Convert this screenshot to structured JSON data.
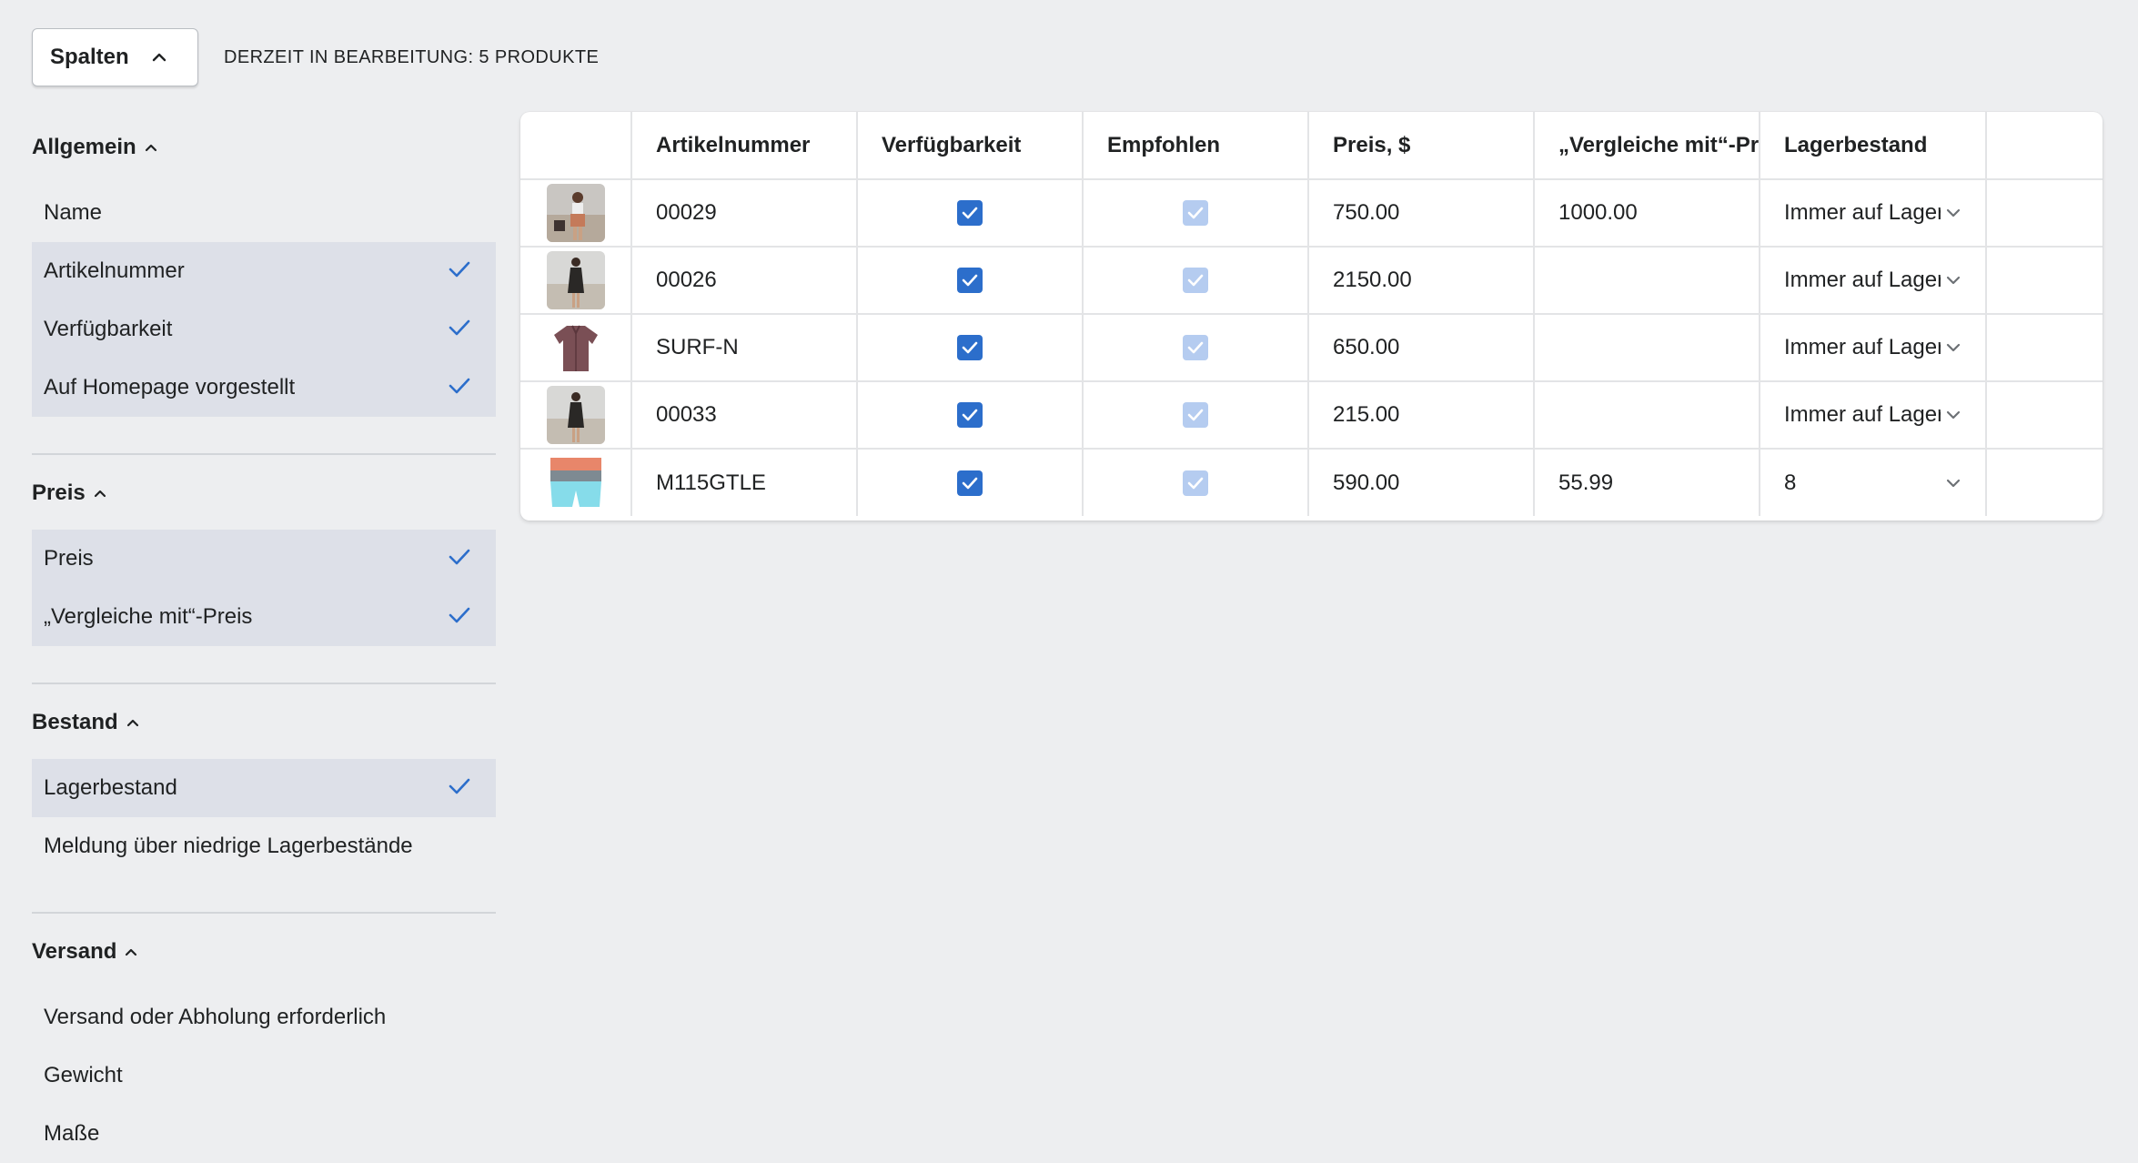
{
  "toolbar": {
    "columns_button_label": "Spalten",
    "editing_status": "DERZEIT IN BEARBEITUNG: 5 PRODUKTE"
  },
  "sidebar": {
    "groups": [
      {
        "title": "Allgemein",
        "items": [
          {
            "label": "Name",
            "selected": false
          },
          {
            "label": "Artikelnummer",
            "selected": true
          },
          {
            "label": "Verfügbarkeit",
            "selected": true
          },
          {
            "label": "Auf Homepage vorgestellt",
            "selected": true
          }
        ]
      },
      {
        "title": "Preis",
        "items": [
          {
            "label": "Preis",
            "selected": true
          },
          {
            "label": "„Vergleiche mit“-Preis",
            "selected": true
          }
        ]
      },
      {
        "title": "Bestand",
        "items": [
          {
            "label": "Lagerbestand",
            "selected": true
          },
          {
            "label": "Meldung über niedrige Lagerbestände",
            "selected": false
          }
        ]
      },
      {
        "title": "Versand",
        "items": [
          {
            "label": "Versand oder Abholung erforderlich",
            "selected": false
          },
          {
            "label": "Gewicht",
            "selected": false
          },
          {
            "label": "Maße",
            "selected": false
          }
        ]
      }
    ]
  },
  "table": {
    "headers": [
      "",
      "Artikelnummer",
      "Verfügbarkeit",
      "Empfohlen",
      "Preis, $",
      "„Vergleiche mit“-Preis",
      "Lagerbestand",
      ""
    ],
    "rows": [
      {
        "image": "product-photo-woman-beach",
        "sku": "00029",
        "available": true,
        "featured": true,
        "price": "750.00",
        "compare_price": "1000.00",
        "stock": "Immer auf Lager"
      },
      {
        "image": "product-photo-black-dress",
        "sku": "00026",
        "available": true,
        "featured": true,
        "price": "2150.00",
        "compare_price": "",
        "stock": "Immer auf Lager"
      },
      {
        "image": "product-photo-shirt",
        "sku": "SURF-N",
        "available": true,
        "featured": true,
        "price": "650.00",
        "compare_price": "",
        "stock": "Immer auf Lager"
      },
      {
        "image": "product-photo-black-dress",
        "sku": "00033",
        "available": true,
        "featured": true,
        "price": "215.00",
        "compare_price": "",
        "stock": "Immer auf Lager"
      },
      {
        "image": "product-photo-board-shorts",
        "sku": "M115GTLE",
        "available": true,
        "featured": true,
        "price": "590.00",
        "compare_price": "55.99",
        "stock": "8"
      }
    ]
  },
  "colors": {
    "background": "#edeef0",
    "selected_item": "#dde0e8",
    "checkmark": "#2c6ecb",
    "checkbox_on": "#2c6ecb",
    "checkbox_disabled": "#b5ccf0"
  }
}
